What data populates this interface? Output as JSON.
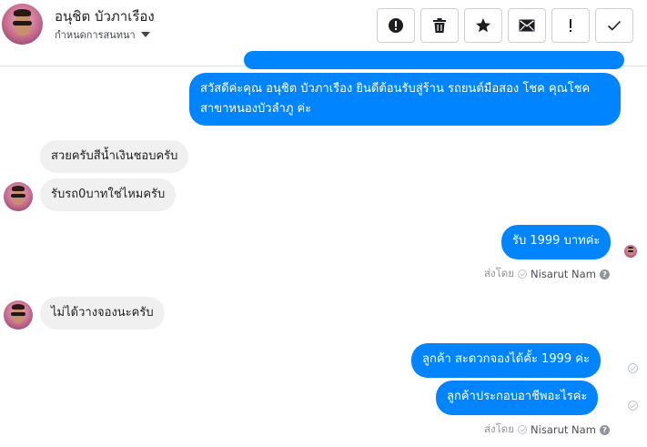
{
  "header": {
    "contact_name": "อนุชิต บัวภาเรือง",
    "conversation_settings": "กำหนดการสนทนา",
    "actions": [
      {
        "name": "report-spam-button",
        "icon": "alert-circle-icon"
      },
      {
        "name": "delete-button",
        "icon": "trash-icon"
      },
      {
        "name": "star-button",
        "icon": "star-icon"
      },
      {
        "name": "mark-unread-button",
        "icon": "envelope-icon"
      },
      {
        "name": "important-button",
        "icon": "exclamation-icon"
      },
      {
        "name": "done-button",
        "icon": "checkmark-icon"
      }
    ]
  },
  "messages": {
    "greeting": "สวัสดีค่ะคุณ อนุชิต บัวภาเรือง ยินดีต้อนรับสู่ร้าน รถยนต์มือสอง โชค คุณโชค สาขาหนองบัวลำภู ค่ะ",
    "in_1": "สวยครับสีน้ำเงินชอบครับ",
    "in_2": "รับรถ0บาทใช่ไหมครับ",
    "out_1": "รับ 1999 บาทค่ะ",
    "sent_by_1_label": "ส่งโดย",
    "sent_by_1_name": "Nisarut Nam",
    "in_3": "ไม่ได้วางจองนะครับ",
    "out_2": "ลูกค้า สะดวกจองได้คั้ะ 1999 ค่ะ",
    "out_3": "ลูกค้าประกอบอาชีพอะไรค่ะ",
    "sent_by_2_label": "ส่งโดย",
    "sent_by_2_name": "Nisarut Nam"
  },
  "colors": {
    "outgoing_bubble": "#0084ff",
    "incoming_bubble": "#f1f0f0",
    "meta_text": "#90949c"
  }
}
